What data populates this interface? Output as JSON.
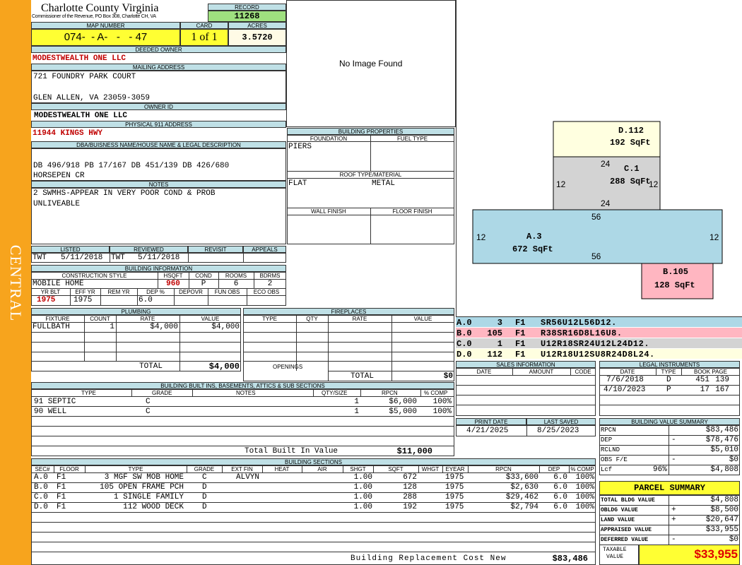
{
  "sidebar": {
    "label": "CENTRAL",
    "color": "#f7a41d"
  },
  "header": {
    "county": "Charlotte County Virginia",
    "commissioner": "Commissioner of the Revenue, PO Box 308, Charlotte CH, VA",
    "record_label": "RECORD",
    "record": "11268",
    "map_number_label": "MAP NUMBER",
    "map_number": "074-  - A-   -   - 47",
    "card_label": "CARD",
    "card": "1 of 1",
    "acres_label": "ACRES",
    "acres": "3.5720"
  },
  "owner": {
    "deeded_owner_label": "DEEDED OWNER",
    "deeded_owner": "MODESTWEALTH ONE LLC",
    "mailing_label": "MAILING ADDRESS",
    "mailing_line1": "721 FOUNDRY PARK COURT",
    "mailing_line2": "GLEN ALLEN, VA 23059-3059",
    "owner_id_label": "OWNER ID",
    "owner_id": "MODESTWEALTH ONE LLC",
    "physical_label": "PHYSICAL 911 ADDRESS",
    "physical": "11944 KINGS HWY",
    "dba_label": "DBA/BUISNESS NAME/HOUSE NAME & LEGAL DESCRIPTION",
    "legal_line1": "DB 496/918 PB 17/167 DB 451/139 DB 426/680",
    "legal_line2": "HORSEPEN CR",
    "notes_label": "NOTES",
    "notes_line1": "2 SWMHS-APPEAR IN VERY POOR COND & PROB",
    "notes_line2": "UNLIVEABLE"
  },
  "image": {
    "no_image": "No Image Found"
  },
  "listing": {
    "listed_label": "LISTED",
    "reviewed_label": "REVIEWED",
    "revisit_label": "REVISIT",
    "appeals_label": "APPEALS",
    "listed_by": "TWT",
    "listed_date": "5/11/2018",
    "reviewed_by": "TWT",
    "reviewed_date": "5/11/2018"
  },
  "building_info": {
    "title": "BUILDING INFORMATION",
    "construction_label": "CONSTRUCTION STYLE",
    "hsqft_label": "HSQFT",
    "cond_label": "COND",
    "rooms_label": "ROOMS",
    "bdrms_label": "BDRMS",
    "construction": "MOBILE HOME",
    "hsqft": "960",
    "cond": "P",
    "rooms": "6",
    "bdrms": "2",
    "yrblt_label": "YR BLT",
    "effyr_label": "EFF YR",
    "remyr_label": "REM YR",
    "dep_label": "DEP %",
    "depovr_label": "DEPOVR",
    "funobs_label": "FUN OBS",
    "ecoobs_label": "ECO OBS",
    "yrblt": "1975",
    "effyr": "1975",
    "dep": "6.0"
  },
  "building_props": {
    "title": "BUILDING PROPERTIES",
    "foundation_label": "FOUNDATION",
    "fuel_label": "FUEL TYPE",
    "foundation": "PIERS",
    "roof_label": "ROOF TYPE/MATERIAL",
    "roof_type": "FLAT",
    "roof_material": "METAL",
    "wall_label": "WALL FINISH",
    "floor_label": "FLOOR FINISH"
  },
  "plumbing": {
    "title": "PLUMBING",
    "headers": [
      "FIXTURE",
      "COUNT",
      "RATE",
      "VALUE"
    ],
    "rows": [
      {
        "fixture": "FULLBATH",
        "count": "1",
        "rate": "$4,000",
        "value": "$4,000"
      }
    ],
    "total_label": "TOTAL",
    "total": "$4,000"
  },
  "fireplaces": {
    "title": "FIREPLACES",
    "headers": [
      "TYPE",
      "QTY",
      "RATE",
      "VALUE"
    ],
    "openings_label": "OPENINGS",
    "total_label": "TOTAL",
    "total": "$0"
  },
  "built_ins": {
    "title": "BUILDING BUILT INS, BASEMENTS, ATTICS & SUB SECTIONS",
    "headers": [
      "TYPE",
      "GRADE",
      "NOTES",
      "QTY/SIZE",
      "RPCN",
      "% COMP"
    ],
    "rows": [
      {
        "type": "91 SEPTIC",
        "grade": "C",
        "notes": "",
        "qty": "1",
        "rpcn": "$6,000",
        "comp": "100%"
      },
      {
        "type": "90 WELL",
        "grade": "C",
        "notes": "",
        "qty": "1",
        "rpcn": "$5,000",
        "comp": "100%"
      }
    ],
    "total_label": "Total Built In Value",
    "total": "$11,000"
  },
  "sections": {
    "title": "BUILDING SECTIONS",
    "headers": [
      "SEC#",
      "FLOOR",
      "TYPE",
      "GRADE",
      "EXT FIN",
      "HEAT",
      "AIR",
      "SHGT",
      "SQFT",
      "WHGT",
      "EYEAR",
      "RPCN",
      "DEP",
      "% COMP"
    ],
    "rows": [
      {
        "sec": "A.0",
        "floor": "F1",
        "type": "3 MGF SW MOB HOME",
        "grade": "C",
        "ext": "ALVYN",
        "shgt": "1.00",
        "sqft": "672",
        "eyear": "1975",
        "rpcn": "$33,600",
        "dep": "6.0",
        "comp": "100%"
      },
      {
        "sec": "B.0",
        "floor": "F1",
        "type": "105 OPEN FRAME PCH",
        "grade": "D",
        "ext": "",
        "shgt": "1.00",
        "sqft": "128",
        "eyear": "1975",
        "rpcn": "$2,630",
        "dep": "6.0",
        "comp": "100%"
      },
      {
        "sec": "C.0",
        "floor": "F1",
        "type": "1 SINGLE FAMILY",
        "grade": "D",
        "ext": "",
        "shgt": "1.00",
        "sqft": "288",
        "eyear": "1975",
        "rpcn": "$29,462",
        "dep": "6.0",
        "comp": "100%"
      },
      {
        "sec": "D.0",
        "floor": "F1",
        "type": "112 WOOD DECK",
        "grade": "D",
        "ext": "",
        "shgt": "1.00",
        "sqft": "192",
        "eyear": "1975",
        "rpcn": "$2,794",
        "dep": "6.0",
        "comp": "100%"
      }
    ],
    "total_label": "Building Replacement Cost New",
    "total": "$83,486"
  },
  "sketch": {
    "d_name": "D.112",
    "d_area": "192 SqFt",
    "c_name": "C.1",
    "c_area": "288 SqFt",
    "a_name": "A.3",
    "a_area": "672 SqFt",
    "b_name": "B.105",
    "b_area": "128 SqFt",
    "dim_24a": "24",
    "dim_24b": "24",
    "dim_12c": "12",
    "dim_12d": "12",
    "dim_56a": "56",
    "dim_56b": "56",
    "dim_12e": "12",
    "dim_12f": "12",
    "colors": {
      "d": "#ffffe0",
      "c": "#d3d3d3",
      "a": "#add8e6",
      "b": "#ffb6c1"
    }
  },
  "vectors": [
    {
      "sec": "A.0",
      "code": "3",
      "floor": "F1",
      "vector": "SR56U12L56D12.",
      "color": "#add8e6"
    },
    {
      "sec": "B.0",
      "code": "105",
      "floor": "F1",
      "vector": "R38SR16D8L16U8.",
      "color": "#ffb6c1"
    },
    {
      "sec": "C.0",
      "code": "1",
      "floor": "F1",
      "vector": "U12R18SR24U12L24D12.",
      "color": "#d3d3d3"
    },
    {
      "sec": "D.0",
      "code": "112",
      "floor": "F1",
      "vector": "U12R18U12SU8R24D8L24.",
      "color": "#ffffe0"
    }
  ],
  "sales": {
    "title": "SALES INFORMATION",
    "headers": [
      "DATE",
      "AMOUNT",
      "CODE"
    ]
  },
  "legal": {
    "title": "LEGAL INSTRUMENTS",
    "headers": [
      "DATE",
      "TYPE",
      "BOOK PAGE"
    ],
    "rows": [
      {
        "date": "7/6/2018",
        "type": "D",
        "book": "451",
        "page": "139"
      },
      {
        "date": "4/10/2023",
        "type": "P",
        "book": "17",
        "page": "167"
      }
    ]
  },
  "print": {
    "print_label": "PRINT DATE",
    "saved_label": "LAST SAVED",
    "print_date": "4/21/2025",
    "saved_date": "8/25/2023"
  },
  "value_summary": {
    "title": "BUILDING VALUE SUMMARY",
    "rows": [
      {
        "label": "RPCN",
        "sign": "",
        "value": "$83,486"
      },
      {
        "label": "DEP",
        "sign": "-",
        "value": "$78,476"
      },
      {
        "label": "RCLND",
        "sign": "",
        "value": "$5,010"
      },
      {
        "label": "OBS F/E",
        "sign": "-",
        "value": "$0"
      },
      {
        "label": "Lcf",
        "pct": "96%",
        "sign": "",
        "value": "$4,808"
      }
    ]
  },
  "parcel": {
    "title": "PARCEL SUMMARY",
    "rows": [
      {
        "label": "TOTAL BLDG VALUE",
        "sign": "",
        "value": "$4,808"
      },
      {
        "label": "OBLDG VALUE",
        "sign": "+",
        "value": "$8,500"
      },
      {
        "label": "LAND VALUE",
        "sign": "+",
        "value": "$20,647"
      },
      {
        "label": "APPRAISED VALUE",
        "sign": "",
        "value": "$33,955"
      },
      {
        "label": "DEFERRED VALUE",
        "sign": "-",
        "value": "$0"
      }
    ],
    "taxable_label_1": "TAXABLE",
    "taxable_label_2": "VALUE",
    "taxable": "$33,955"
  }
}
